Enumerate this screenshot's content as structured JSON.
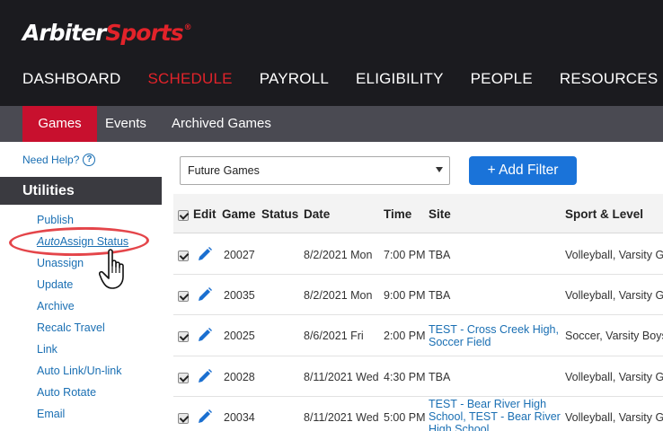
{
  "brand": {
    "logo_white": "Arbiter",
    "logo_red": "Sports",
    "trademark": "®"
  },
  "colors": {
    "accent_red": "#c8102e",
    "link_blue": "#1a6fb3",
    "button_blue": "#1a73d9",
    "header_bg": "#1b1b1f"
  },
  "main_nav": [
    {
      "label": "DASHBOARD",
      "active": false
    },
    {
      "label": "SCHEDULE",
      "active": true
    },
    {
      "label": "PAYROLL",
      "active": false
    },
    {
      "label": "ELIGIBILITY",
      "active": false
    },
    {
      "label": "PEOPLE",
      "active": false
    },
    {
      "label": "RESOURCES",
      "active": false
    }
  ],
  "sub_nav": [
    {
      "label": "Games",
      "active": true
    },
    {
      "label": "Events",
      "active": false
    },
    {
      "label": "Archived Games",
      "active": false
    }
  ],
  "sidebar": {
    "help": "Need Help?",
    "help_icon": "question-circle-icon",
    "utilities_title": "Utilities",
    "items": [
      {
        "label": "Publish"
      },
      {
        "label_italic": "Auto",
        "label_rest": "Assign Status",
        "highlighted": true
      },
      {
        "label": "Unassign"
      },
      {
        "label": "Update"
      },
      {
        "label": "Archive"
      },
      {
        "label": "Recalc Travel"
      },
      {
        "label": "Link"
      },
      {
        "label": "Auto Link/Un-link"
      },
      {
        "label": "Auto Rotate"
      },
      {
        "label": "Email"
      }
    ]
  },
  "filter": {
    "selected": "Future Games",
    "add_filter_label": "+ Add Filter"
  },
  "table": {
    "headers": {
      "edit": "Edit",
      "game": "Game",
      "status": "Status",
      "date": "Date",
      "time": "Time",
      "site": "Site",
      "sport": "Sport & Level"
    },
    "rows": [
      {
        "game": "20027",
        "date": "8/2/2021 Mon",
        "time": "7:00 PM",
        "site": "TBA",
        "site_link": false,
        "sport": "Volleyball, Varsity Girls"
      },
      {
        "game": "20035",
        "date": "8/2/2021 Mon",
        "time": "9:00 PM",
        "site": "TBA",
        "site_link": false,
        "sport": "Volleyball, Varsity Girls"
      },
      {
        "game": "20025",
        "date": "8/6/2021 Fri",
        "time": "2:00 PM",
        "site": "TEST - Cross Creek High, Soccer Field",
        "site_link": true,
        "sport": "Soccer, Varsity Boys"
      },
      {
        "game": "20028",
        "date": "8/11/2021 Wed",
        "time": "4:30 PM",
        "site": "TBA",
        "site_link": false,
        "sport": "Volleyball, Varsity Girls"
      },
      {
        "game": "20034",
        "date": "8/11/2021 Wed",
        "time": "5:00 PM",
        "site": "TEST - Bear River High School, TEST - Bear River High School",
        "site_link": true,
        "sport": "Volleyball, Varsity Girls"
      }
    ]
  }
}
